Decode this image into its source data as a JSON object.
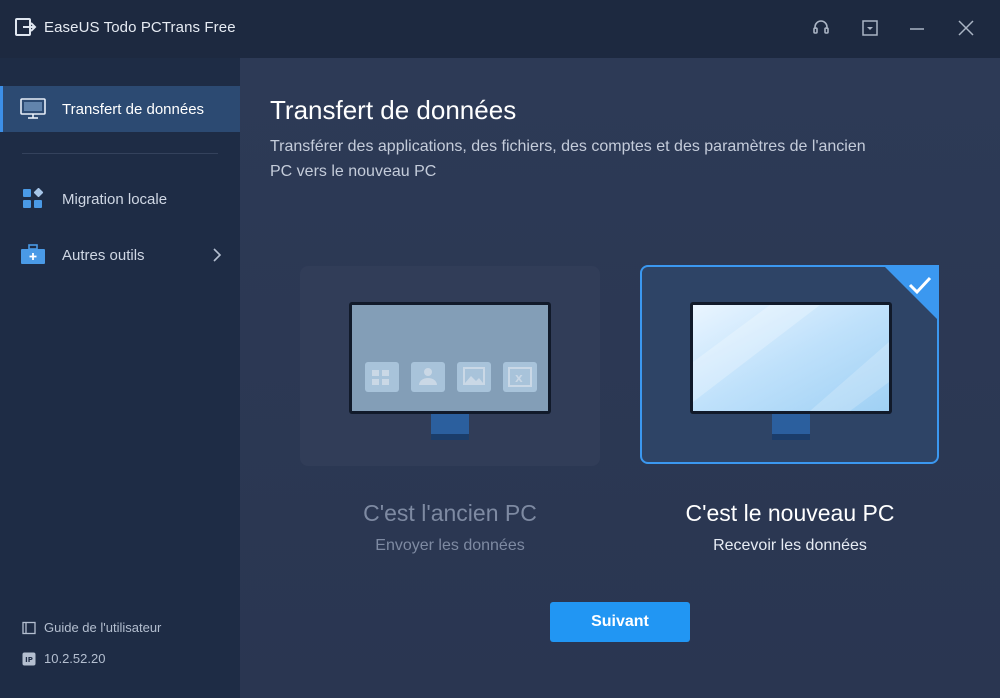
{
  "window": {
    "title": "EaseUS Todo PCTrans Free",
    "controls": [
      "headset-icon",
      "minimize-to-tray-icon",
      "minimize-icon",
      "close-icon"
    ]
  },
  "sidebar": {
    "items": [
      {
        "label": "Transfert de données",
        "icon": "monitor-icon",
        "active": true
      },
      {
        "label": "Migration locale",
        "icon": "apps-grid-icon",
        "active": false
      },
      {
        "label": "Autres outils",
        "icon": "toolbox-icon",
        "active": false,
        "has_submenu": true
      }
    ],
    "footer": {
      "guide_label": "Guide de l'utilisateur",
      "version": "10.2.52.20"
    }
  },
  "main": {
    "title": "Transfert de données",
    "description": "Transférer des applications, des fichiers, des comptes et des paramètres de l'ancien PC vers le nouveau PC",
    "options": {
      "old": {
        "title": "C'est l'ancien PC",
        "subtitle": "Envoyer les données",
        "selected": false
      },
      "new": {
        "title": "C'est le nouveau PC",
        "subtitle": "Recevoir les données",
        "selected": true
      }
    },
    "next_button": "Suivant"
  },
  "colors": {
    "accent": "#2196f3",
    "selected_border": "#3b98f0",
    "sidebar_bg": "#1e2c45",
    "main_bg": "#2d3a56"
  }
}
